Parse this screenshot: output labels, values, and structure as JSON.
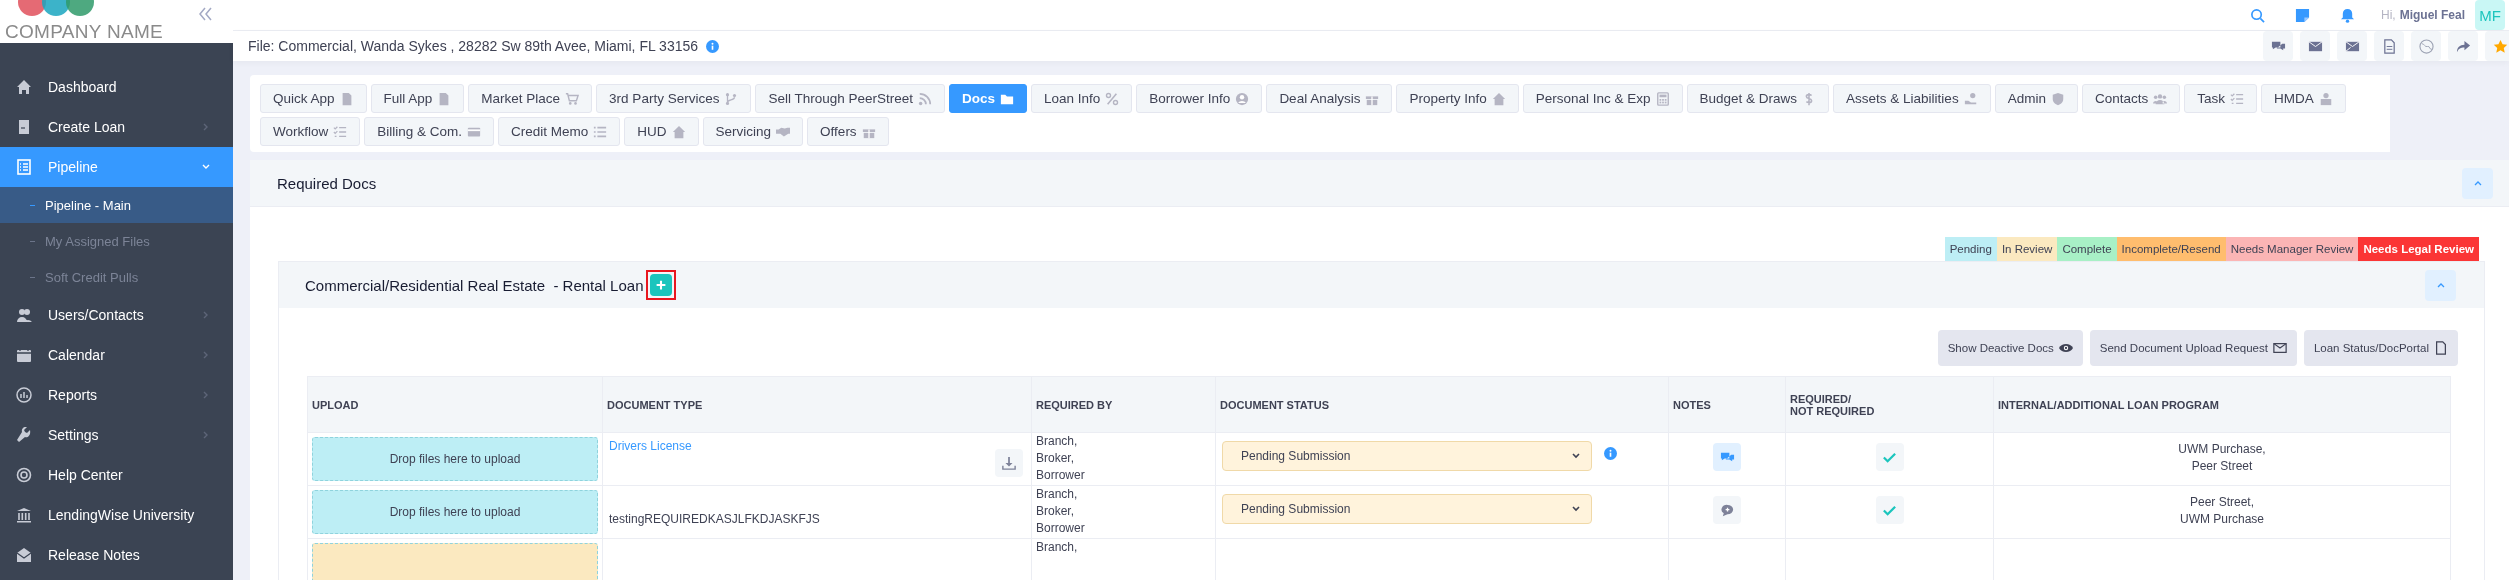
{
  "logo": {
    "company_name": "COMPANY NAME"
  },
  "topbar": {
    "greeting": "Hi,",
    "user_name": "Miguel Feal",
    "avatar_initials": "MF"
  },
  "sidebar": {
    "items": [
      {
        "label": "Dashboard",
        "kind": "link",
        "selected": false
      },
      {
        "label": "Create Loan",
        "kind": "menu",
        "selected": false,
        "expanded": false
      },
      {
        "label": "Pipeline",
        "kind": "menu",
        "selected": true,
        "expanded": true,
        "children": [
          {
            "label": "Pipeline - Main",
            "selected": true
          },
          {
            "label": "My Assigned Files",
            "selected": false
          },
          {
            "label": "Soft Credit Pulls",
            "selected": false
          }
        ]
      },
      {
        "label": "Users/Contacts",
        "kind": "menu",
        "selected": false,
        "expanded": false
      },
      {
        "label": "Calendar",
        "kind": "menu",
        "selected": false,
        "expanded": false
      },
      {
        "label": "Reports",
        "kind": "menu",
        "selected": false,
        "expanded": false
      },
      {
        "label": "Settings",
        "kind": "menu",
        "selected": false,
        "expanded": false
      },
      {
        "label": "Help Center",
        "kind": "link",
        "selected": false
      },
      {
        "label": "LendingWise University",
        "kind": "link",
        "selected": false
      },
      {
        "label": "Release Notes",
        "kind": "link",
        "selected": false
      }
    ]
  },
  "file_bar": {
    "title": "File: Commercial, Wanda Sykes , 28282 Sw 89th Avee, Miami, FL 33156"
  },
  "tabs": [
    {
      "label": "Quick App",
      "selected": false
    },
    {
      "label": "Full App",
      "selected": false
    },
    {
      "label": "Market Place",
      "selected": false
    },
    {
      "label": "3rd Party Services",
      "selected": false
    },
    {
      "label": "Sell Through PeerStreet",
      "selected": false
    },
    {
      "label": "Docs",
      "selected": true
    },
    {
      "label": "Loan Info",
      "selected": false
    },
    {
      "label": "Borrower Info",
      "selected": false
    },
    {
      "label": "Deal Analysis",
      "selected": false
    },
    {
      "label": "Property Info",
      "selected": false
    },
    {
      "label": "Personal Inc & Exp",
      "selected": false
    },
    {
      "label": "Budget & Draws",
      "selected": false
    },
    {
      "label": "Assets & Liabilities",
      "selected": false
    },
    {
      "label": "Admin",
      "selected": false
    },
    {
      "label": "Contacts",
      "selected": false
    },
    {
      "label": "Task",
      "selected": false
    },
    {
      "label": "HMDA",
      "selected": false
    },
    {
      "label": "Workflow",
      "selected": false
    },
    {
      "label": "Billing & Com.",
      "selected": false
    },
    {
      "label": "Credit Memo",
      "selected": false
    },
    {
      "label": "HUD",
      "selected": false
    },
    {
      "label": "Servicing",
      "selected": false
    },
    {
      "label": "Offers",
      "selected": false
    }
  ],
  "required_docs": {
    "title": "Required Docs",
    "expanded": true
  },
  "legend": [
    {
      "label": "Pending",
      "color": "#bdeef5"
    },
    {
      "label": "In Review",
      "color": "#fbe9c0"
    },
    {
      "label": "Complete",
      "color": "#a8f0c6"
    },
    {
      "label": "Incomplete/Resend",
      "color": "#ffbd6e"
    },
    {
      "label": "Needs Manager Review",
      "color": "#fbb5b5"
    },
    {
      "label": "Needs Legal Review",
      "color": "#fb3535"
    }
  ],
  "section": {
    "title": "Commercial/Residential Real Estate  - Rental Loan",
    "highlighted": true,
    "expanded": true
  },
  "actions": [
    "Show Deactive Docs",
    "Send Document Upload Request",
    "Loan Status/DocPortal"
  ],
  "table": {
    "columns": [
      "UPLOAD",
      "DOCUMENT TYPE",
      "REQUIRED BY",
      "DOCUMENT STATUS",
      "NOTES",
      "REQUIRED/\nNOT REQUIRED",
      "INTERNAL/ADDITIONAL LOAN PROGRAM"
    ],
    "rows": [
      {
        "upload_text": "Drop files here to upload",
        "color": "#bdeef5",
        "document_type": "Drivers License",
        "kind": "link",
        "downloadable": true,
        "required_by": [
          "Branch,",
          "Broker,",
          "Borrower"
        ],
        "status": "Pending Submission",
        "info": true,
        "has_notes": true,
        "required": true,
        "programs": [
          "UWM Purchase,",
          "Peer Street"
        ]
      },
      {
        "upload_text": "Drop files here to upload",
        "color": "#bdeef5",
        "document_type": "testingREQUIREDKASJLFKDJASKFJS",
        "kind": "text",
        "downloadable": false,
        "required_by": [
          "Branch,",
          "Broker,",
          "Borrower"
        ],
        "status": "Pending Submission",
        "info": false,
        "has_notes": false,
        "required": true,
        "programs": [
          "Peer Street,",
          "UWM Purchase"
        ]
      },
      {
        "color": "#fbe9c0",
        "required_by": [
          "Branch,"
        ]
      }
    ]
  }
}
